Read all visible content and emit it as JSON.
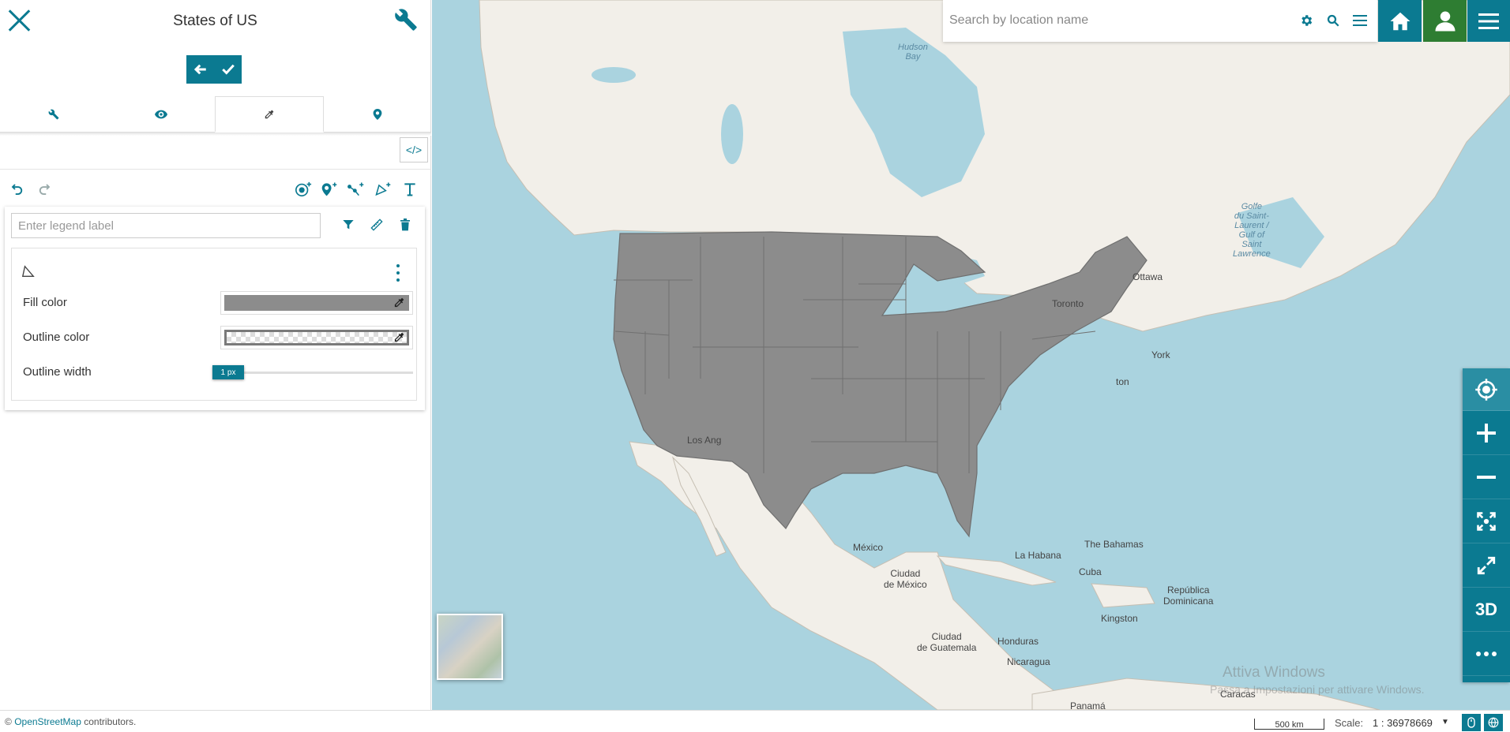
{
  "panel": {
    "title": "States of US",
    "legend_placeholder": "Enter legend label",
    "code_label": "</>",
    "fill_color_label": "Fill color",
    "outline_color_label": "Outline color",
    "outline_width_label": "Outline width",
    "outline_width_value": "1 px",
    "outline_width_fraction": 0.05,
    "fill_color": "#8c8c8c",
    "outline_color": "#7a7a7a",
    "active_tab": "style"
  },
  "search": {
    "placeholder": "Search by location name"
  },
  "map_labels": {
    "hudson_bay": "Hudson\nBay",
    "ottawa": "Ottawa",
    "toronto": "Toronto",
    "york": "York",
    "washington": "ton",
    "los_angeles": "Los Ang",
    "golfe": "Golfe\ndu Saint-\nLaurent /\nGulf of\nSaint\nLawrence",
    "mexico": "México",
    "ciudad_mexico": "Ciudad\nde México",
    "la_habana": "La Habana",
    "bahamas": "The Bahamas",
    "cuba": "Cuba",
    "republica_dominicana": "República\nDominicana",
    "kingston": "Kingston",
    "ciudad_guatemala": "Ciudad\nde Guatemala",
    "honduras": "Honduras",
    "nicaragua": "Nicaragua",
    "caracas": "Caracas",
    "panama": "Panamá"
  },
  "watermark": {
    "line1": "Attiva Windows",
    "line2": "Passa a Impostazioni per attivare Windows."
  },
  "side_controls": {
    "three_d": "3D"
  },
  "footer": {
    "attribution_prefix": "©",
    "attribution_link": "OpenStreetMap",
    "attribution_suffix": "contributors.",
    "scalebar": "500 km",
    "scale_label": "Scale:",
    "scale_value": "1 : 36978669"
  },
  "colors": {
    "accent": "#0b7a91",
    "map_water": "#aad3df",
    "map_land": "#f2efe9",
    "us_fill": "#8c8c8c",
    "home_bg": "#0b7a91",
    "user_bg": "#2e7d32"
  }
}
